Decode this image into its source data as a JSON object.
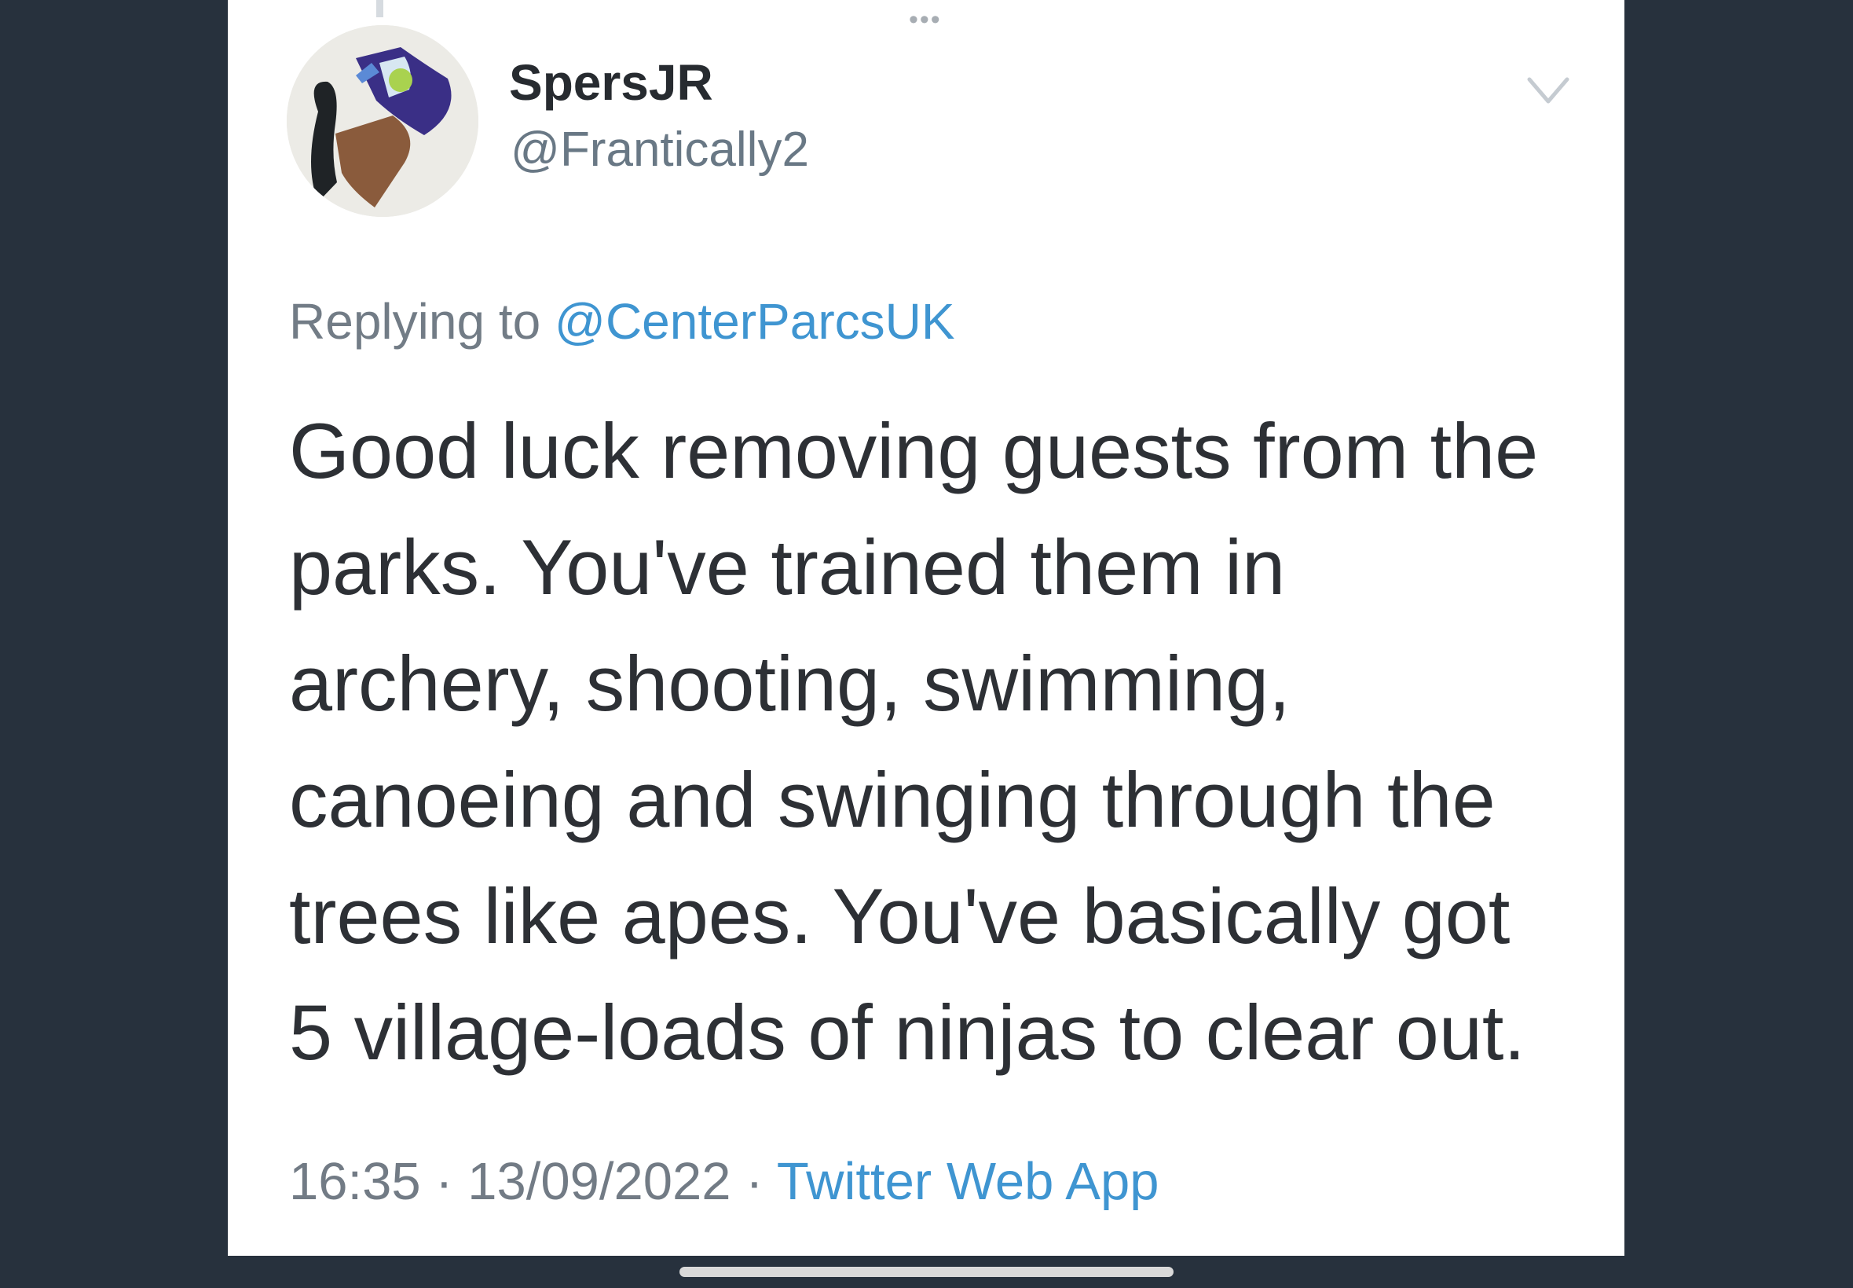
{
  "tweet": {
    "display_name": "SpersJR",
    "handle": "@Frantically2",
    "replying_prefix": "Replying to",
    "replying_handle": "@CenterParcsUK",
    "text_lines": [
      "Good luck removing guests from the",
      "parks. You've trained them in",
      "archery, shooting, swimming,",
      "canoeing and swinging through the",
      "trees like apes. You've basically got",
      "5 village-loads of ninjas to clear out."
    ],
    "time": "16:35",
    "separator": "·",
    "date": "13/09/2022",
    "source_app": "Twitter Web App"
  },
  "icons": {
    "more": "more-dots-icon",
    "menu": "chevron-down-icon"
  },
  "colors": {
    "background": "#27313d",
    "card": "#ffffff",
    "link": "#3f95d1",
    "muted_text": "#727b85",
    "body_text": "#2d3035"
  }
}
